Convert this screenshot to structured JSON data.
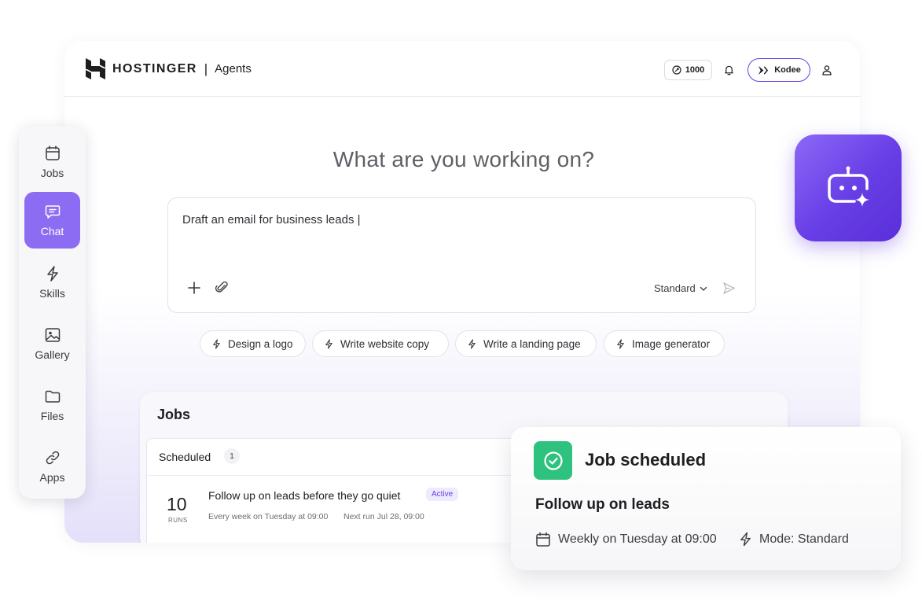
{
  "header": {
    "brand": "HOSTINGER",
    "separator": "|",
    "product": "Agents",
    "credits": "1000",
    "assistant_label": "Kodee"
  },
  "main": {
    "headline": "What are you working on?",
    "prompt_value": "Draft an email for business leads |",
    "mode_label": "Standard",
    "suggestions": [
      "Design a logo",
      "Write website copy",
      "Write a landing page",
      "Image generator"
    ]
  },
  "sidebar": {
    "items": [
      {
        "label": "Jobs",
        "icon": "calendar-icon",
        "active": false
      },
      {
        "label": "Chat",
        "icon": "chat-icon",
        "active": true
      },
      {
        "label": "Skills",
        "icon": "bolt-icon",
        "active": false
      },
      {
        "label": "Gallery",
        "icon": "image-icon",
        "active": false
      },
      {
        "label": "Files",
        "icon": "folder-icon",
        "active": false
      },
      {
        "label": "Apps",
        "icon": "link-icon",
        "active": false
      }
    ]
  },
  "jobs": {
    "title": "Jobs",
    "tab_label": "Scheduled",
    "tab_count": "1",
    "job": {
      "runs": "10",
      "runs_label": "RUNS",
      "name": "Follow up on leads before they go quiet",
      "status": "Active",
      "schedule": "Every week on Tuesday at 09:00",
      "next_run": "Next run Jul 28, 09:00"
    }
  },
  "toast": {
    "title": "Job scheduled",
    "job_name": "Follow up on leads",
    "schedule": "Weekly on Tuesday at 09:00",
    "mode": "Mode: Standard"
  },
  "colors": {
    "accent": "#673de6",
    "accent_light": "#8c6cf2",
    "success": "#2ec27e"
  }
}
